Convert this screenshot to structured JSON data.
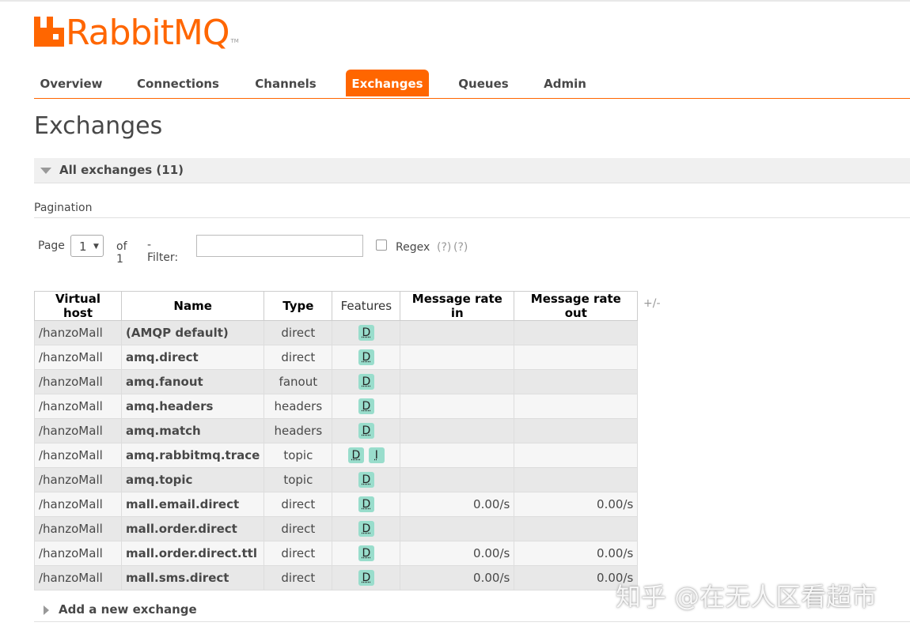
{
  "logo": {
    "text": "RabbitMQ",
    "tm": "TM",
    "brand_color": "#ff6600"
  },
  "nav": {
    "tabs": [
      {
        "label": "Overview"
      },
      {
        "label": "Connections"
      },
      {
        "label": "Channels"
      },
      {
        "label": "Exchanges",
        "active": true
      },
      {
        "label": "Queues"
      },
      {
        "label": "Admin"
      }
    ]
  },
  "page": {
    "title": "Exchanges"
  },
  "all_exchanges": {
    "label": "All exchanges (11)"
  },
  "pagination": {
    "section_label": "Pagination",
    "page_label": "Page",
    "page_value": "1",
    "of_label": "of 1",
    "filter_label": "- Filter:",
    "filter_value": "",
    "regex_label": "Regex",
    "help_1": "(?)",
    "help_2": "(?)"
  },
  "table": {
    "columns": [
      "Virtual host",
      "Name",
      "Type",
      "Features",
      "Message rate in",
      "Message rate out"
    ],
    "toggle_label": "+/-",
    "rows": [
      {
        "vhost": "/hanzoMall",
        "name": "(AMQP default)",
        "type": "direct",
        "features": [
          "D"
        ],
        "rate_in": "",
        "rate_out": ""
      },
      {
        "vhost": "/hanzoMall",
        "name": "amq.direct",
        "type": "direct",
        "features": [
          "D"
        ],
        "rate_in": "",
        "rate_out": ""
      },
      {
        "vhost": "/hanzoMall",
        "name": "amq.fanout",
        "type": "fanout",
        "features": [
          "D"
        ],
        "rate_in": "",
        "rate_out": ""
      },
      {
        "vhost": "/hanzoMall",
        "name": "amq.headers",
        "type": "headers",
        "features": [
          "D"
        ],
        "rate_in": "",
        "rate_out": ""
      },
      {
        "vhost": "/hanzoMall",
        "name": "amq.match",
        "type": "headers",
        "features": [
          "D"
        ],
        "rate_in": "",
        "rate_out": ""
      },
      {
        "vhost": "/hanzoMall",
        "name": "amq.rabbitmq.trace",
        "type": "topic",
        "features": [
          "D",
          "I"
        ],
        "rate_in": "",
        "rate_out": ""
      },
      {
        "vhost": "/hanzoMall",
        "name": "amq.topic",
        "type": "topic",
        "features": [
          "D"
        ],
        "rate_in": "",
        "rate_out": ""
      },
      {
        "vhost": "/hanzoMall",
        "name": "mall.email.direct",
        "type": "direct",
        "features": [
          "D"
        ],
        "rate_in": "0.00/s",
        "rate_out": "0.00/s"
      },
      {
        "vhost": "/hanzoMall",
        "name": "mall.order.direct",
        "type": "direct",
        "features": [
          "D"
        ],
        "rate_in": "",
        "rate_out": ""
      },
      {
        "vhost": "/hanzoMall",
        "name": "mall.order.direct.ttl",
        "type": "direct",
        "features": [
          "D"
        ],
        "rate_in": "0.00/s",
        "rate_out": "0.00/s"
      },
      {
        "vhost": "/hanzoMall",
        "name": "mall.sms.direct",
        "type": "direct",
        "features": [
          "D"
        ],
        "rate_in": "0.00/s",
        "rate_out": "0.00/s"
      }
    ]
  },
  "add_exchange": {
    "label": "Add a new exchange"
  },
  "watermark": {
    "text": "知乎 @在无人区看超市"
  }
}
